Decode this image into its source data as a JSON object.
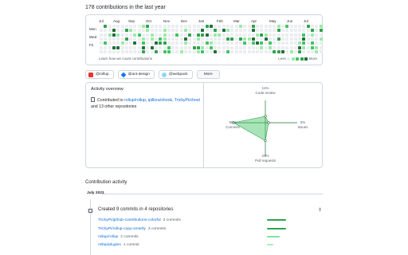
{
  "contributions_heading": "178 contributions in the last year",
  "calendar": {
    "months": [
      "Jul",
      "Aug",
      "Sep",
      "Oct",
      "Nov",
      "Dec",
      "Jan",
      "Feb",
      "Mar",
      "Apr",
      "May",
      "Jun",
      "Jul"
    ],
    "weekdays": [
      "Mon",
      "Wed",
      "Fri"
    ],
    "learn_link": "Learn how we count contributions",
    "legend_less": "Less",
    "legend_more": "More",
    "colors": [
      "#ebedf0",
      "#9be9a8",
      "#40c463",
      "#30a14e",
      "#216e39"
    ]
  },
  "orgs": [
    {
      "label": "@rollup",
      "icon": "rollup-logo-icon",
      "color": "#ef3335"
    },
    {
      "label": "@ant-design",
      "icon": "ant-design-logo-icon",
      "color": "#1677ff"
    },
    {
      "label": "@webpack",
      "icon": "webpack-logo-icon",
      "color": "#8ed6fb"
    }
  ],
  "more_button": "More",
  "overview": {
    "title": "Activity overview",
    "prefix": "Contributed to",
    "repo1": "rollup/rollup",
    "sep1": ",",
    "repo2": "ipillora/xhook",
    "sep2": ",",
    "repo3": "TrickyPi/chost",
    "suffix": "and 13 other repositories"
  },
  "radar": {
    "code_review_pct": "11%",
    "code_review_label": "Code review",
    "issues_pct": "3%",
    "issues_label": "Issues",
    "pull_requests_pct": "31%",
    "pull_requests_label": "Pull requests",
    "commits_pct": "55%",
    "commits_label": "Commits",
    "values": {
      "code_review": 11,
      "issues": 3,
      "pull_requests": 31,
      "commits": 55
    }
  },
  "activity": {
    "title": "Contribution activity",
    "month": "July 2023",
    "created_title": "Created 9 commits in 4 repositories",
    "repos": [
      {
        "name": "TrickyPi/github-contributions-colorful",
        "count": "3 commits",
        "share": 1.0
      },
      {
        "name": "TrickyPi/rollup-copy-smartly",
        "count": "3 commits",
        "share": 1.0
      },
      {
        "name": "rollup/rollup",
        "count": "2 commits",
        "share": 0.67
      },
      {
        "name": "rollup/plugins",
        "count": "1 commit",
        "share": 0.33
      }
    ]
  }
}
